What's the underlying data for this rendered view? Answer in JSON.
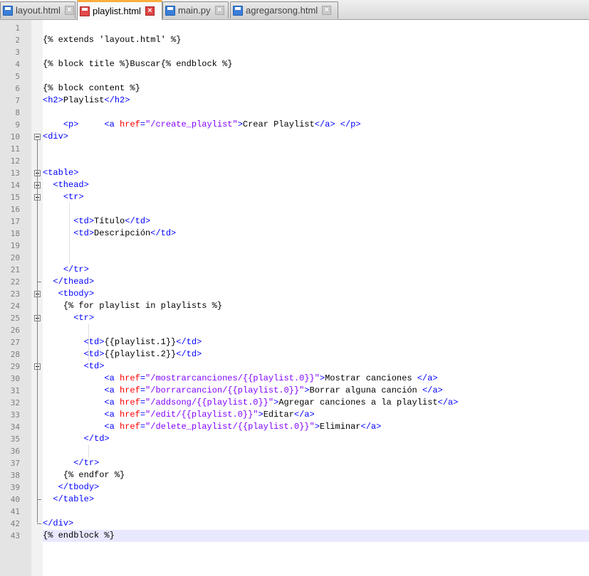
{
  "tabs": [
    {
      "label": "layout.html",
      "state": "saved",
      "active": false
    },
    {
      "label": "playlist.html",
      "state": "unsaved",
      "active": true
    },
    {
      "label": "main.py",
      "state": "saved",
      "active": false
    },
    {
      "label": "agregarsong.html",
      "state": "saved",
      "active": false
    }
  ],
  "colors": {
    "tag": "#0000ff",
    "attribute": "#ff0000",
    "value": "#8000ff",
    "text": "#000000",
    "active_tab_accent": "#fbae3c"
  },
  "editor": {
    "current_line": 43,
    "lines": [
      {
        "n": "1",
        "tokens": []
      },
      {
        "n": "2",
        "tokens": [
          {
            "t": "text",
            "v": "{% extends 'layout.html' %}"
          }
        ]
      },
      {
        "n": "3",
        "tokens": []
      },
      {
        "n": "4",
        "tokens": [
          {
            "t": "text",
            "v": "{% block title %}Buscar{% endblock %}"
          }
        ]
      },
      {
        "n": "5",
        "tokens": []
      },
      {
        "n": "6",
        "tokens": [
          {
            "t": "text",
            "v": "{% block content %}"
          }
        ]
      },
      {
        "n": "7",
        "tokens": [
          {
            "t": "tag",
            "v": "<h2>"
          },
          {
            "t": "text",
            "v": "Playlist"
          },
          {
            "t": "tag",
            "v": "</h2>"
          }
        ]
      },
      {
        "n": "8",
        "tokens": []
      },
      {
        "n": "9",
        "tokens": [
          {
            "t": "text",
            "v": "    "
          },
          {
            "t": "tag",
            "v": "<p>"
          },
          {
            "t": "text",
            "v": "     "
          },
          {
            "t": "tag",
            "v": "<a "
          },
          {
            "t": "attr",
            "v": "href"
          },
          {
            "t": "tag",
            "v": "="
          },
          {
            "t": "val",
            "v": "\"/create_playlist\""
          },
          {
            "t": "tag",
            "v": ">"
          },
          {
            "t": "text",
            "v": "Crear Playlist"
          },
          {
            "t": "tag",
            "v": "</a>"
          },
          {
            "t": "text",
            "v": " "
          },
          {
            "t": "tag",
            "v": "</p>"
          }
        ]
      },
      {
        "n": "10",
        "tokens": [
          {
            "t": "tag",
            "v": "<div>"
          }
        ]
      },
      {
        "n": "11",
        "tokens": []
      },
      {
        "n": "12",
        "tokens": []
      },
      {
        "n": "13",
        "tokens": [
          {
            "t": "tag",
            "v": "<table>"
          }
        ]
      },
      {
        "n": "14",
        "tokens": [
          {
            "t": "text",
            "v": "  "
          },
          {
            "t": "tag",
            "v": "<thead>"
          }
        ]
      },
      {
        "n": "15",
        "tokens": [
          {
            "t": "text",
            "v": "    "
          },
          {
            "t": "tag",
            "v": "<tr>"
          }
        ]
      },
      {
        "n": "16",
        "tokens": []
      },
      {
        "n": "17",
        "tokens": [
          {
            "t": "text",
            "v": "      "
          },
          {
            "t": "tag",
            "v": "<td>"
          },
          {
            "t": "text",
            "v": "Título"
          },
          {
            "t": "tag",
            "v": "</td>"
          }
        ]
      },
      {
        "n": "18",
        "tokens": [
          {
            "t": "text",
            "v": "      "
          },
          {
            "t": "tag",
            "v": "<td>"
          },
          {
            "t": "text",
            "v": "Descripción"
          },
          {
            "t": "tag",
            "v": "</td>"
          }
        ]
      },
      {
        "n": "19",
        "tokens": []
      },
      {
        "n": "20",
        "tokens": []
      },
      {
        "n": "21",
        "tokens": [
          {
            "t": "text",
            "v": "    "
          },
          {
            "t": "tag",
            "v": "</tr>"
          }
        ]
      },
      {
        "n": "22",
        "tokens": [
          {
            "t": "text",
            "v": "  "
          },
          {
            "t": "tag",
            "v": "</thead>"
          }
        ]
      },
      {
        "n": "23",
        "tokens": [
          {
            "t": "text",
            "v": "   "
          },
          {
            "t": "tag",
            "v": "<tbody>"
          }
        ]
      },
      {
        "n": "24",
        "tokens": [
          {
            "t": "text",
            "v": "    {% for playlist in playlists %}"
          }
        ]
      },
      {
        "n": "25",
        "tokens": [
          {
            "t": "text",
            "v": "      "
          },
          {
            "t": "tag",
            "v": "<tr>"
          }
        ]
      },
      {
        "n": "26",
        "tokens": []
      },
      {
        "n": "27",
        "tokens": [
          {
            "t": "text",
            "v": "        "
          },
          {
            "t": "tag",
            "v": "<td>"
          },
          {
            "t": "text",
            "v": "{{playlist.1}}"
          },
          {
            "t": "tag",
            "v": "</td>"
          }
        ]
      },
      {
        "n": "28",
        "tokens": [
          {
            "t": "text",
            "v": "        "
          },
          {
            "t": "tag",
            "v": "<td>"
          },
          {
            "t": "text",
            "v": "{{playlist.2}}"
          },
          {
            "t": "tag",
            "v": "</td>"
          }
        ]
      },
      {
        "n": "29",
        "tokens": [
          {
            "t": "text",
            "v": "        "
          },
          {
            "t": "tag",
            "v": "<td>"
          }
        ]
      },
      {
        "n": "30",
        "tokens": [
          {
            "t": "text",
            "v": "            "
          },
          {
            "t": "tag",
            "v": "<a "
          },
          {
            "t": "attr",
            "v": "href"
          },
          {
            "t": "tag",
            "v": "="
          },
          {
            "t": "val",
            "v": "\"/mostrarcanciones/{{playlist.0}}\""
          },
          {
            "t": "tag",
            "v": ">"
          },
          {
            "t": "text",
            "v": "Mostrar canciones "
          },
          {
            "t": "tag",
            "v": "</a>"
          }
        ]
      },
      {
        "n": "31",
        "tokens": [
          {
            "t": "text",
            "v": "            "
          },
          {
            "t": "tag",
            "v": "<a "
          },
          {
            "t": "attr",
            "v": "href"
          },
          {
            "t": "tag",
            "v": "="
          },
          {
            "t": "val",
            "v": "\"/borrarcancion/{{playlist.0}}\""
          },
          {
            "t": "tag",
            "v": ">"
          },
          {
            "t": "text",
            "v": "Borrar alguna canción "
          },
          {
            "t": "tag",
            "v": "</a>"
          }
        ]
      },
      {
        "n": "32",
        "tokens": [
          {
            "t": "text",
            "v": "            "
          },
          {
            "t": "tag",
            "v": "<a "
          },
          {
            "t": "attr",
            "v": "href"
          },
          {
            "t": "tag",
            "v": "="
          },
          {
            "t": "val",
            "v": "\"/addsong/{{playlist.0}}\""
          },
          {
            "t": "tag",
            "v": ">"
          },
          {
            "t": "text",
            "v": "Agregar canciones a la playlist"
          },
          {
            "t": "tag",
            "v": "</a>"
          }
        ]
      },
      {
        "n": "33",
        "tokens": [
          {
            "t": "text",
            "v": "            "
          },
          {
            "t": "tag",
            "v": "<a "
          },
          {
            "t": "attr",
            "v": "href"
          },
          {
            "t": "tag",
            "v": "="
          },
          {
            "t": "val",
            "v": "\"/edit/{{playlist.0}}\""
          },
          {
            "t": "tag",
            "v": ">"
          },
          {
            "t": "text",
            "v": "Editar"
          },
          {
            "t": "tag",
            "v": "</a>"
          }
        ]
      },
      {
        "n": "34",
        "tokens": [
          {
            "t": "text",
            "v": "            "
          },
          {
            "t": "tag",
            "v": "<a "
          },
          {
            "t": "attr",
            "v": "href"
          },
          {
            "t": "tag",
            "v": "="
          },
          {
            "t": "val",
            "v": "\"/delete_playlist/{{playlist.0}}\""
          },
          {
            "t": "tag",
            "v": ">"
          },
          {
            "t": "text",
            "v": "Eliminar"
          },
          {
            "t": "tag",
            "v": "</a>"
          }
        ]
      },
      {
        "n": "35",
        "tokens": [
          {
            "t": "text",
            "v": "        "
          },
          {
            "t": "tag",
            "v": "</td>"
          }
        ]
      },
      {
        "n": "36",
        "tokens": []
      },
      {
        "n": "37",
        "tokens": [
          {
            "t": "text",
            "v": "      "
          },
          {
            "t": "tag",
            "v": "</tr>"
          }
        ]
      },
      {
        "n": "38",
        "tokens": [
          {
            "t": "text",
            "v": "    {% endfor %}"
          }
        ]
      },
      {
        "n": "39",
        "tokens": [
          {
            "t": "text",
            "v": "   "
          },
          {
            "t": "tag",
            "v": "</tbody>"
          }
        ]
      },
      {
        "n": "40",
        "tokens": [
          {
            "t": "text",
            "v": "  "
          },
          {
            "t": "tag",
            "v": "</table>"
          }
        ]
      },
      {
        "n": "41",
        "tokens": []
      },
      {
        "n": "42",
        "tokens": [
          {
            "t": "tag",
            "v": "</div>"
          }
        ]
      },
      {
        "n": "43",
        "tokens": [
          {
            "t": "text",
            "v": "{% endblock %}"
          }
        ]
      }
    ]
  }
}
